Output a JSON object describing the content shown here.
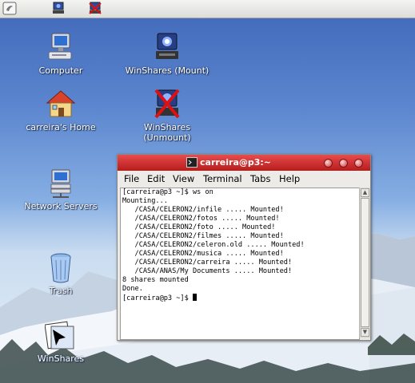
{
  "desktop": {
    "icons": [
      {
        "label": "Computer"
      },
      {
        "label": "WinShares (Mount)"
      },
      {
        "label": "carreira's Home"
      },
      {
        "label": "WinShares\n(Unmount)"
      },
      {
        "label": "Network Servers"
      },
      {
        "label": "Trash"
      },
      {
        "label": "WinShares"
      }
    ]
  },
  "terminal": {
    "title": "carreira@p3:~",
    "menu": [
      "File",
      "Edit",
      "View",
      "Terminal",
      "Tabs",
      "Help"
    ],
    "lines": [
      "[carreira@p3 ~]$ ws on",
      "Mounting...",
      "   /CASA/CELERON2/infile ..... Mounted!",
      "   /CASA/CELERON2/fotos ..... Mounted!",
      "   /CASA/CELERON2/foto ..... Mounted!",
      "   /CASA/CELERON2/filmes ..... Mounted!",
      "   /CASA/CELERON2/celeron.old ..... Mounted!",
      "   /CASA/CELERON2/musica ..... Mounted!",
      "   /CASA/CELERON2/carreira ..... Mounted!",
      "   /CASA/ANAS/My Documents ..... Mounted!",
      "8 shares mounted",
      "Done.",
      "[carreira@p3 ~]$ "
    ]
  },
  "panel": {
    "icons": [
      "main-menu-icon",
      "winshares-mount-launcher-icon",
      "winshares-unmount-launcher-icon"
    ]
  },
  "colors": {
    "titlebar": "#c82a2a",
    "sky_top": "#3f67b8"
  }
}
